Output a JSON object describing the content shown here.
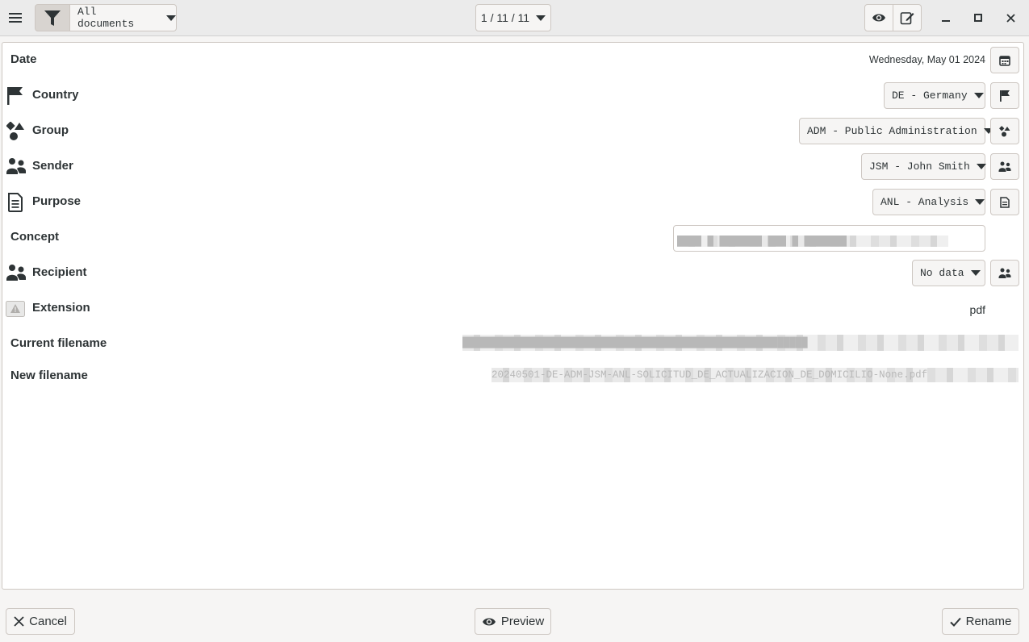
{
  "header": {
    "menu_icon": "hamburger-menu-icon",
    "filter_icon": "filter-funnel-icon",
    "filter_dropdown": "All documents",
    "page_counter": "1 / 11 / 11",
    "preview_icon": "eye-icon",
    "edit_icon": "edit-note-icon",
    "window_controls": [
      "minimize",
      "maximize",
      "close"
    ]
  },
  "form": {
    "date": {
      "label": "Date",
      "value": "Wednesday, May 01 2024",
      "icon": "calendar-icon"
    },
    "country": {
      "label": "Country",
      "value": "DE - Germany",
      "icon": "flag-icon"
    },
    "group": {
      "label": "Group",
      "value": "ADM - Public Administration",
      "icon": "shapes-icon"
    },
    "sender": {
      "label": "Sender",
      "value": "JSM - John Smith",
      "icon": "people-icon"
    },
    "purpose": {
      "label": "Purpose",
      "value": "ANL - Analysis",
      "icon": "document-icon"
    },
    "concept": {
      "label": "Concept",
      "value": "████ █ ███████ ███ █ ███████"
    },
    "recipient": {
      "label": "Recipient",
      "value": "No data",
      "icon": "people-icon"
    },
    "extension": {
      "label": "Extension",
      "value": "pdf",
      "icon": "warning-icon"
    },
    "current_filename": {
      "label": "Current filename",
      "value": "█████████████████████████████████████████████████████████"
    },
    "new_filename": {
      "label": "New filename",
      "value": "20240501-DE-ADM-JSM-ANL-SOLICITUD_DE_ACTUALIZACION_DE_DOMICILIO-None.pdf"
    }
  },
  "footer": {
    "cancel": "Cancel",
    "preview": "Preview",
    "rename": "Rename"
  }
}
